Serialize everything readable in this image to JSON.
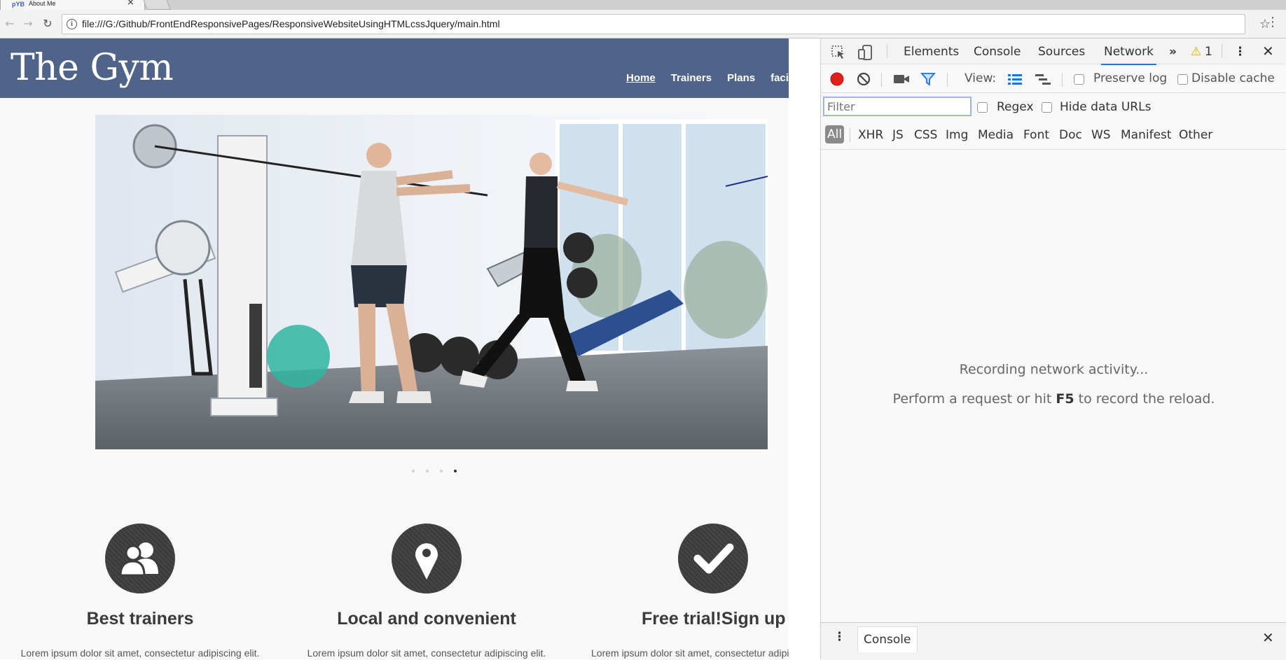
{
  "browser": {
    "tab_title": "About Me",
    "tab_favicon": "pYB",
    "url": "file:///G:/Github/FrontEndResponsivePages/ResponsiveWebsiteUsingHTMLcssJquery/main.html"
  },
  "site": {
    "logo": "The Gym",
    "nav": [
      {
        "label": "Home",
        "active": true
      },
      {
        "label": "Trainers",
        "active": false
      },
      {
        "label": "Plans",
        "active": false
      },
      {
        "label": "facility",
        "active": false
      }
    ],
    "slider": {
      "slides": 4,
      "active_index": 3
    },
    "features": [
      {
        "icon": "users-icon",
        "title": "Best trainers",
        "text": "Lorem ipsum dolor sit amet, consectetur adipiscing elit."
      },
      {
        "icon": "map-pin-icon",
        "title": "Local and convenient",
        "text": "Lorem ipsum dolor sit amet, consectetur adipiscing elit."
      },
      {
        "icon": "checkmark-icon",
        "title": "Free trial!Sign up",
        "text": "Lorem ipsum dolor sit amet, consectetur adipi"
      }
    ]
  },
  "devtools": {
    "tabs": [
      "Elements",
      "Console",
      "Sources",
      "Network"
    ],
    "active_tab": "Network",
    "more": "»",
    "warnings": "1",
    "view_label": "View:",
    "preserve_log": "Preserve log",
    "disable_cache": "Disable cache",
    "filter_placeholder": "Filter",
    "regex": "Regex",
    "hide_data_urls": "Hide data URLs",
    "types": [
      "All",
      "XHR",
      "JS",
      "CSS",
      "Img",
      "Media",
      "Font",
      "Doc",
      "WS",
      "Manifest",
      "Other"
    ],
    "recording": "Recording network activity...",
    "hint_prefix": "Perform a request or hit",
    "hint_key": "F5",
    "hint_suffix": "to record the reload.",
    "drawer_tab": "Console"
  },
  "colors": {
    "header_bg": "#4f6488",
    "record_red": "#e0201b",
    "accent_blue": "#1a73e8"
  }
}
